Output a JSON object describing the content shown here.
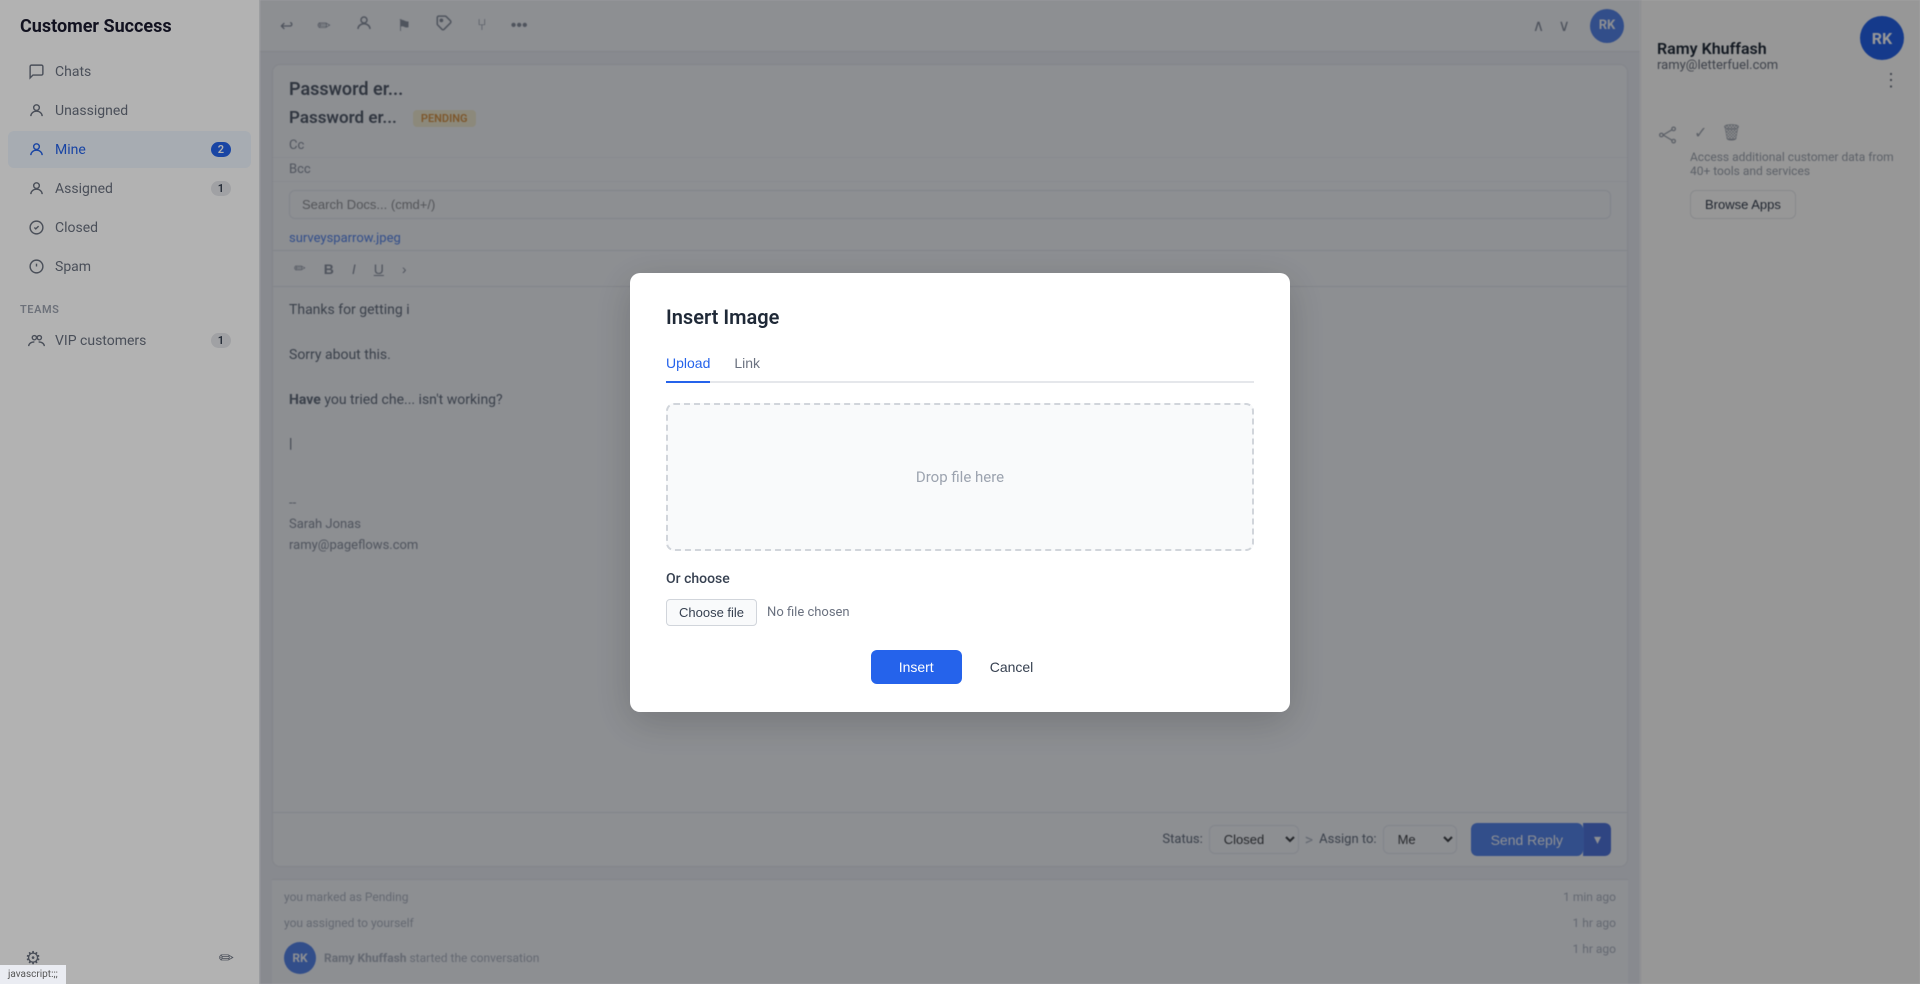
{
  "app": {
    "title": "Customer Success"
  },
  "sidebar": {
    "chats_label": "Chats",
    "unassigned_label": "Unassigned",
    "mine_label": "Mine",
    "mine_badge": "2",
    "assigned_label": "Assigned",
    "assigned_badge": "1",
    "closed_label": "Closed",
    "spam_label": "Spam",
    "teams_section": "TEAMS",
    "vip_label": "VIP customers",
    "vip_badge": "1",
    "settings_icon": "⚙",
    "compose_icon": "✏"
  },
  "toolbar": {
    "undo_icon": "↩",
    "edit_icon": "✏",
    "assign_icon": "👤",
    "flag_icon": "⚑",
    "tag_icon": "🏷",
    "fork_icon": "⑂",
    "more_icon": "•••",
    "nav_up_icon": "∧",
    "nav_down_icon": "∨"
  },
  "chat": {
    "title": "Password er...",
    "pending_badge": "PENDING",
    "cc_label": "Cc",
    "bcc_label": "Bcc",
    "search_placeholder": "Search Docs... (cmd+/)",
    "attachment": "surveysparrow.jpeg",
    "body_line1": "Thanks for getting i",
    "body_line2": "Sorry about this.",
    "body_line3_bold": "Have",
    "body_line3_rest": " you tried che... isn't working?",
    "cursor_line": "|",
    "signature_dashes": "--",
    "signature_name": "Sarah Jonas",
    "signature_email": "ramy@pageflows.com"
  },
  "format_bar": {
    "pen_icon": "✏",
    "bold_icon": "B",
    "italic_icon": "I",
    "underline_icon": "U",
    "more_icon": ">"
  },
  "compose_footer": {
    "status_label": "Status:",
    "status_value": "Closed",
    "arrow_icon": ">",
    "assign_label": "Assign to:",
    "assign_value": "Me",
    "send_label": "Send Reply",
    "caret_icon": "▾"
  },
  "activity": {
    "marked_text": "you marked as Pending",
    "marked_time": "1 min ago",
    "assigned_text": "you assigned to yourself",
    "assigned_time": "1 hr ago",
    "started_text": "Ramy Khuffash started the conversation",
    "started_time": "1 hr ago"
  },
  "right_panel": {
    "contact_name": "Ramy Khuffash",
    "contact_email": "ramy@letterfuel.com",
    "avatar_initials": "RK",
    "more_icon": "⋮",
    "integrations_title": "Access additional customer data from 40+ tools and services",
    "browse_apps_label": "Browse Apps",
    "check_icon": "✓",
    "trash_icon": "🗑"
  },
  "modal": {
    "title": "Insert Image",
    "tab_upload": "Upload",
    "tab_link": "Link",
    "drop_zone_text": "Drop file here",
    "or_choose_text": "Or choose",
    "choose_file_label": "Choose file",
    "no_file_text": "No file chosen",
    "insert_label": "Insert",
    "cancel_label": "Cancel"
  },
  "status_bar": {
    "text": "javascript:;;"
  }
}
